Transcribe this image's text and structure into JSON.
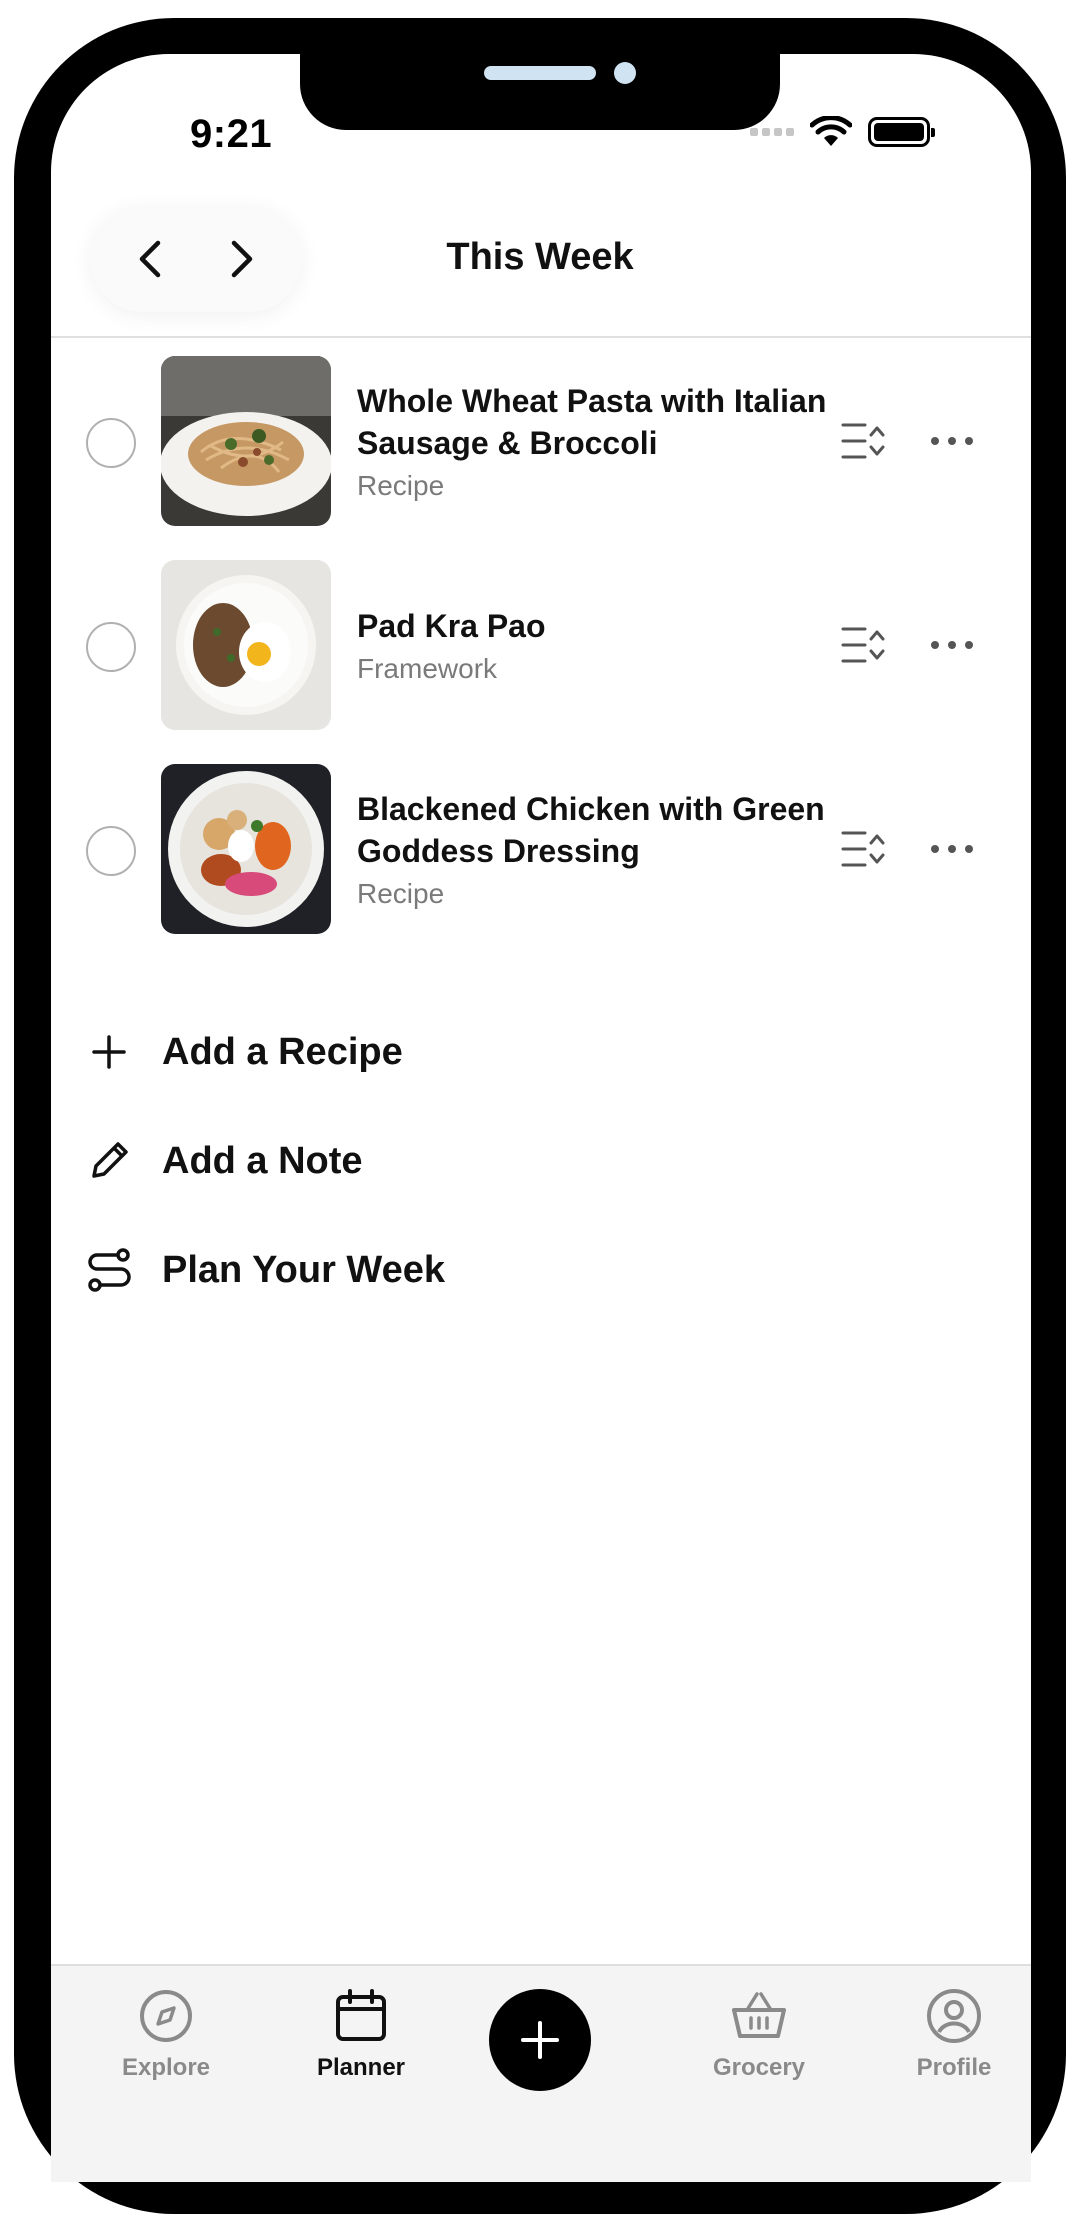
{
  "status_bar": {
    "time": "9:21"
  },
  "header": {
    "title": "This Week"
  },
  "meals": [
    {
      "title": "Whole Wheat Pasta with Italian Sausage & Broccoli",
      "type": "Recipe"
    },
    {
      "title": "Pad Kra Pao",
      "type": "Framework"
    },
    {
      "title": "Blackened Chicken with Green Goddess Dressing",
      "type": "Recipe"
    }
  ],
  "actions": [
    {
      "label": "Add a Recipe",
      "icon": "plus-icon"
    },
    {
      "label": "Add a Note",
      "icon": "pencil-icon"
    },
    {
      "label": "Plan Your Week",
      "icon": "route-icon"
    }
  ],
  "tab_bar": {
    "tabs": [
      {
        "label": "Explore",
        "icon": "compass-icon",
        "active": false
      },
      {
        "label": "Planner",
        "icon": "calendar-icon",
        "active": true
      },
      {
        "label": "Grocery",
        "icon": "basket-icon",
        "active": false
      },
      {
        "label": "Profile",
        "icon": "user-circle-icon",
        "active": false
      }
    ],
    "center_button_icon": "plus-icon"
  },
  "colors": {
    "text": "#111111",
    "muted": "#7a7a7a",
    "tab_inactive": "#8a8a8a",
    "tab_bar_bg": "#f4f4f4",
    "fab_bg": "#000000"
  }
}
